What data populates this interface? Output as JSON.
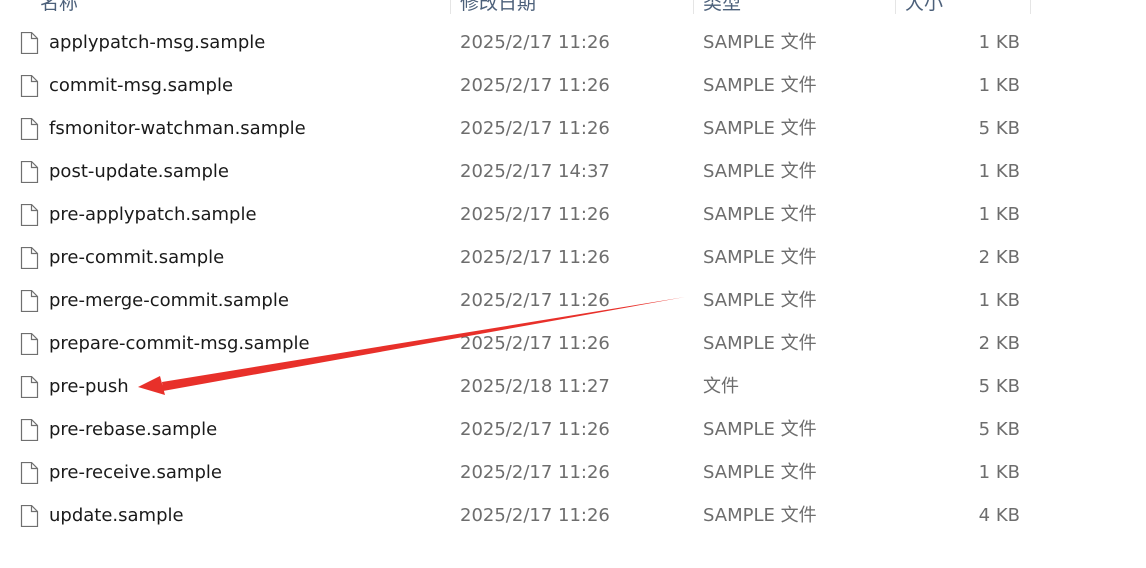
{
  "header": {
    "columns": [
      {
        "label": "名称"
      },
      {
        "label": "修改日期"
      },
      {
        "label": "类型"
      },
      {
        "label": "大小"
      }
    ]
  },
  "files": [
    {
      "name": "applypatch-msg.sample",
      "date": "2025/2/17 11:26",
      "type": "SAMPLE 文件",
      "size": "1 KB"
    },
    {
      "name": "commit-msg.sample",
      "date": "2025/2/17 11:26",
      "type": "SAMPLE 文件",
      "size": "1 KB"
    },
    {
      "name": "fsmonitor-watchman.sample",
      "date": "2025/2/17 11:26",
      "type": "SAMPLE 文件",
      "size": "5 KB"
    },
    {
      "name": "post-update.sample",
      "date": "2025/2/17 14:37",
      "type": "SAMPLE 文件",
      "size": "1 KB"
    },
    {
      "name": "pre-applypatch.sample",
      "date": "2025/2/17 11:26",
      "type": "SAMPLE 文件",
      "size": "1 KB"
    },
    {
      "name": "pre-commit.sample",
      "date": "2025/2/17 11:26",
      "type": "SAMPLE 文件",
      "size": "2 KB"
    },
    {
      "name": "pre-merge-commit.sample",
      "date": "2025/2/17 11:26",
      "type": "SAMPLE 文件",
      "size": "1 KB"
    },
    {
      "name": "prepare-commit-msg.sample",
      "date": "2025/2/17 11:26",
      "type": "SAMPLE 文件",
      "size": "2 KB"
    },
    {
      "name": "pre-push",
      "date": "2025/2/18 11:27",
      "type": "文件",
      "size": "5 KB"
    },
    {
      "name": "pre-rebase.sample",
      "date": "2025/2/17 11:26",
      "type": "SAMPLE 文件",
      "size": "5 KB"
    },
    {
      "name": "pre-receive.sample",
      "date": "2025/2/17 11:26",
      "type": "SAMPLE 文件",
      "size": "1 KB"
    },
    {
      "name": "update.sample",
      "date": "2025/2/17 11:26",
      "type": "SAMPLE 文件",
      "size": "4 KB"
    }
  ],
  "colors": {
    "annotation_arrow": "#e8302a",
    "secondary_text": "#6d6d6d",
    "primary_text": "#1a1a1a",
    "header_text": "#4c607a"
  },
  "icons": {
    "file": "file-icon",
    "annotation": "red-arrow-pointing-to-pre-push"
  }
}
